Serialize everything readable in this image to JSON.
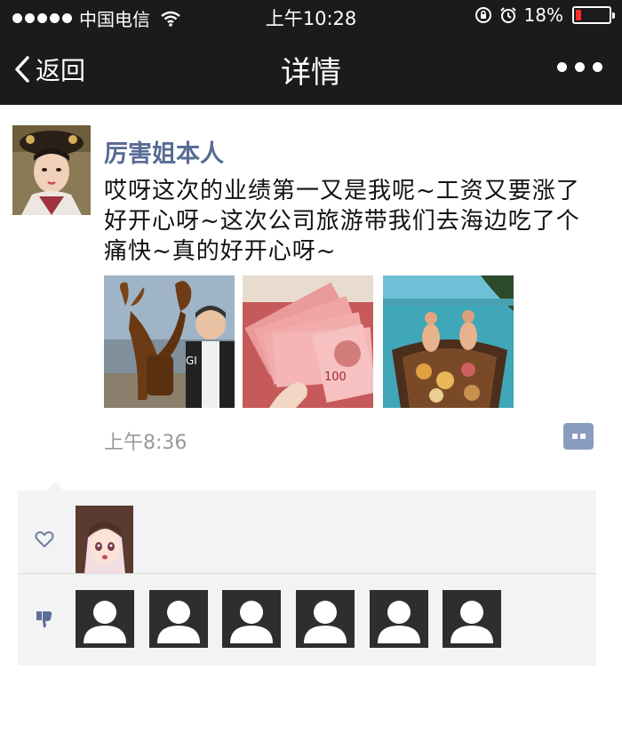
{
  "status_bar": {
    "carrier": "中国电信",
    "time": "上午10:28",
    "battery_percent": "18%",
    "battery_level": 0.18,
    "battery_color": "#ff2d2d"
  },
  "nav": {
    "back_label": "返回",
    "title": "详情"
  },
  "post": {
    "username": "厉害姐本人",
    "text": "哎呀这次的业绩第一又是我呢~工资又要涨了好开心呀~这次公司旅游带我们去海边吃了个痛快~真的好开心呀~",
    "time": "上午8:36",
    "photos": [
      "lobster-photo",
      "money-photo",
      "beach-boat-photo"
    ]
  },
  "likes": {
    "liked_users": [
      "anime-avatar"
    ],
    "disliked_count": 6
  },
  "colors": {
    "nav_background": "#1b1b1d",
    "username": "#576b95",
    "accent": "#8b9dbf"
  }
}
